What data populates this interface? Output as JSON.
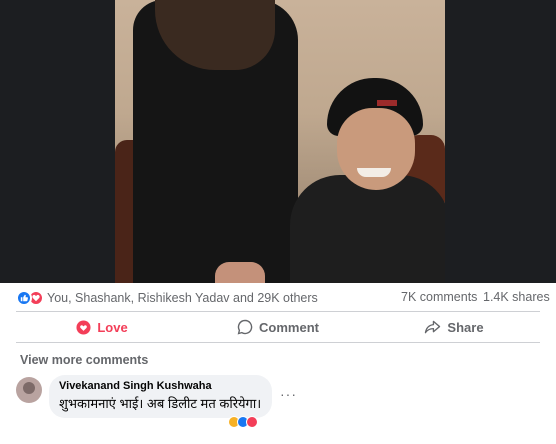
{
  "post": {
    "reactions": {
      "icons": [
        "like-icon",
        "love-icon"
      ],
      "summary": "You, Shashank, Rishikesh Yadav and 29K others"
    },
    "comments_count": "7K comments",
    "shares_count": "1.4K shares",
    "actions": [
      {
        "label": "Love",
        "icon": "heart-icon",
        "color": "#f33e58"
      },
      {
        "label": "Comment",
        "icon": "comment-icon"
      },
      {
        "label": "Share",
        "icon": "share-icon"
      }
    ]
  },
  "comments": {
    "view_more": "View more comments",
    "items": [
      {
        "author": "Vivekanand Singh Kushwaha",
        "text": "शुभकामनाएं भाई। अब डिलीट मत करियेगा।",
        "more": "···"
      }
    ]
  },
  "colors": {
    "like": "#1877f2",
    "love": "#f33e58",
    "muted_text": "#65676b",
    "bubble": "#f0f2f5"
  }
}
